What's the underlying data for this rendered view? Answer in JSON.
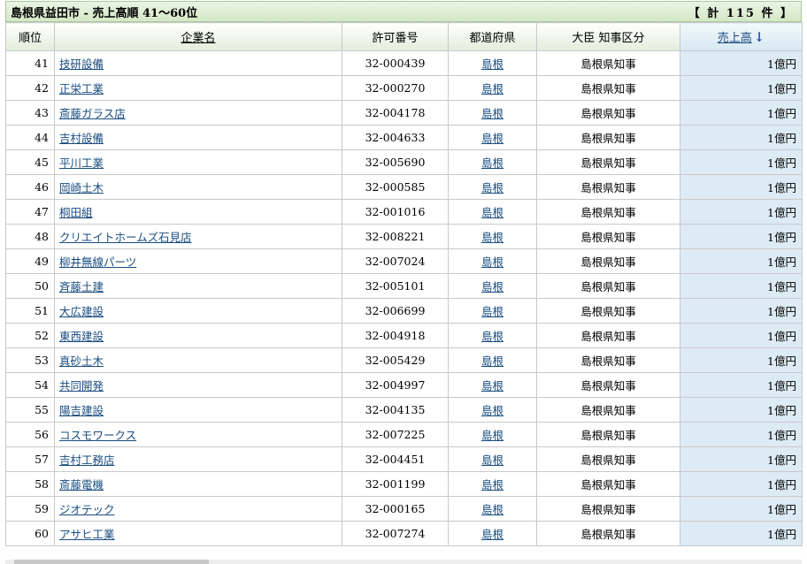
{
  "header": {
    "title": "島根県益田市 - 売上高順 41～60位",
    "count": "【 計 115 件 】"
  },
  "columns": {
    "rank": "順位",
    "name": "企業名",
    "license": "許可番号",
    "prefecture": "都道府県",
    "category": "大臣 知事区分",
    "sales": "売上高"
  },
  "rows": [
    {
      "rank": "41",
      "name": "技研設備",
      "license": "32-000439",
      "pref": "島根",
      "cat": "島根県知事",
      "sales": "1億円"
    },
    {
      "rank": "42",
      "name": "正栄工業",
      "license": "32-000270",
      "pref": "島根",
      "cat": "島根県知事",
      "sales": "1億円"
    },
    {
      "rank": "43",
      "name": "斎藤ガラス店",
      "license": "32-004178",
      "pref": "島根",
      "cat": "島根県知事",
      "sales": "1億円"
    },
    {
      "rank": "44",
      "name": "吉村設備",
      "license": "32-004633",
      "pref": "島根",
      "cat": "島根県知事",
      "sales": "1億円"
    },
    {
      "rank": "45",
      "name": "平川工業",
      "license": "32-005690",
      "pref": "島根",
      "cat": "島根県知事",
      "sales": "1億円"
    },
    {
      "rank": "46",
      "name": "岡崎土木",
      "license": "32-000585",
      "pref": "島根",
      "cat": "島根県知事",
      "sales": "1億円"
    },
    {
      "rank": "47",
      "name": "桐田組",
      "license": "32-001016",
      "pref": "島根",
      "cat": "島根県知事",
      "sales": "1億円"
    },
    {
      "rank": "48",
      "name": "クリエイトホームズ石見店",
      "license": "32-008221",
      "pref": "島根",
      "cat": "島根県知事",
      "sales": "1億円"
    },
    {
      "rank": "49",
      "name": "柳井無線パーツ",
      "license": "32-007024",
      "pref": "島根",
      "cat": "島根県知事",
      "sales": "1億円"
    },
    {
      "rank": "50",
      "name": "斉藤土建",
      "license": "32-005101",
      "pref": "島根",
      "cat": "島根県知事",
      "sales": "1億円"
    },
    {
      "rank": "51",
      "name": "大広建設",
      "license": "32-006699",
      "pref": "島根",
      "cat": "島根県知事",
      "sales": "1億円"
    },
    {
      "rank": "52",
      "name": "東西建設",
      "license": "32-004918",
      "pref": "島根",
      "cat": "島根県知事",
      "sales": "1億円"
    },
    {
      "rank": "53",
      "name": "真砂土木",
      "license": "32-005429",
      "pref": "島根",
      "cat": "島根県知事",
      "sales": "1億円"
    },
    {
      "rank": "54",
      "name": "共同開発",
      "license": "32-004997",
      "pref": "島根",
      "cat": "島根県知事",
      "sales": "1億円"
    },
    {
      "rank": "55",
      "name": "陽吉建設",
      "license": "32-004135",
      "pref": "島根",
      "cat": "島根県知事",
      "sales": "1億円"
    },
    {
      "rank": "56",
      "name": "コスモワークス",
      "license": "32-007225",
      "pref": "島根",
      "cat": "島根県知事",
      "sales": "1億円"
    },
    {
      "rank": "57",
      "name": "吉村工務店",
      "license": "32-004451",
      "pref": "島根",
      "cat": "島根県知事",
      "sales": "1億円"
    },
    {
      "rank": "58",
      "name": "斎藤電機",
      "license": "32-001199",
      "pref": "島根",
      "cat": "島根県知事",
      "sales": "1億円"
    },
    {
      "rank": "59",
      "name": "ジオテック",
      "license": "32-000165",
      "pref": "島根",
      "cat": "島根県知事",
      "sales": "1億円"
    },
    {
      "rank": "60",
      "name": "アサヒ工業",
      "license": "32-007274",
      "pref": "島根",
      "cat": "島根県知事",
      "sales": "1億円"
    }
  ],
  "colors": {
    "link": "#1a4d80",
    "sort_arrow": "#1e50b4",
    "sorted_column_bg": "#dcebf4",
    "title_bar_bg": "#d5e8c7"
  },
  "icons": {
    "sort": "arrow-down-icon"
  }
}
